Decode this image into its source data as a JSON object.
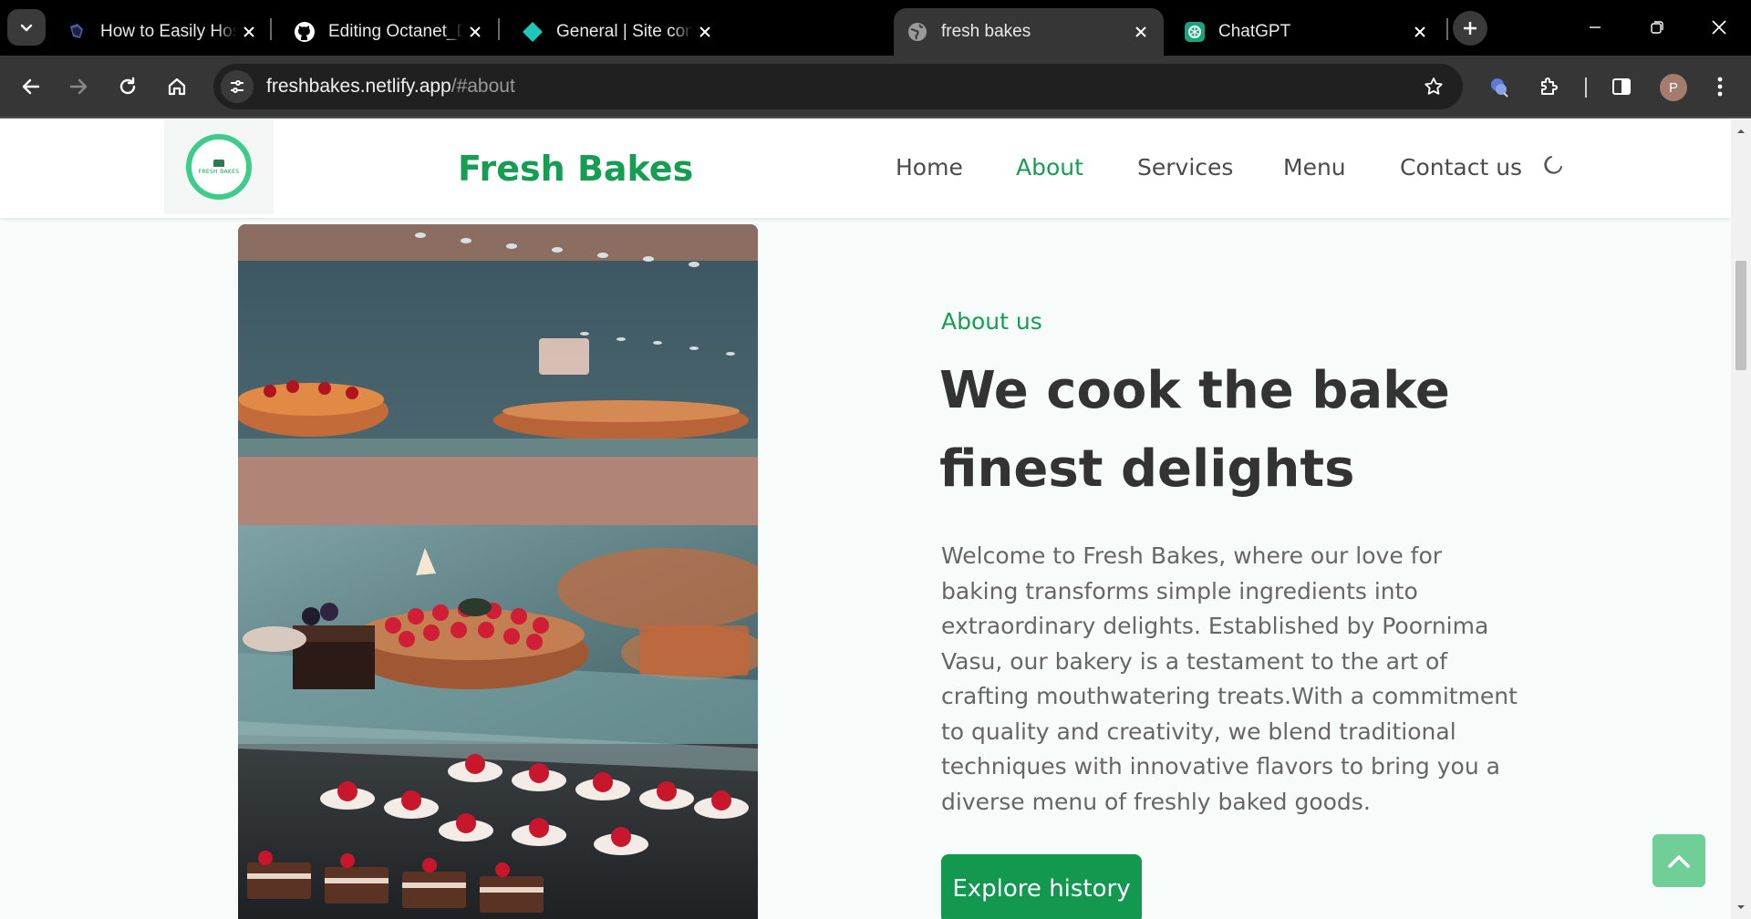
{
  "browser": {
    "tabs": [
      {
        "title": "How to Easily Host a Website",
        "favicon": "dev-icon",
        "active": false
      },
      {
        "title": "Editing Octanet_December",
        "favicon": "github-icon",
        "active": false
      },
      {
        "title": "General | Site configuration",
        "favicon": "netlify-icon",
        "active": false
      },
      {
        "title": "fresh bakes",
        "favicon": "globe-icon",
        "active": true
      },
      {
        "title": "ChatGPT",
        "favicon": "chatgpt-icon",
        "active": false
      }
    ],
    "url_host": "freshbakes.netlify.app",
    "url_path": "/#about",
    "profile_initial": "P"
  },
  "site": {
    "logo_text": "FRESH BAKES",
    "brand": "Fresh Bakes",
    "nav": [
      {
        "label": "Home",
        "active": false
      },
      {
        "label": "About",
        "active": true
      },
      {
        "label": "Services",
        "active": false
      },
      {
        "label": "Menu",
        "active": false
      },
      {
        "label": "Contact us",
        "active": false
      }
    ],
    "about": {
      "eyebrow": "About us",
      "headline": "We cook the bake finest delights",
      "body": "Welcome to Fresh Bakes, where our love for baking transforms simple ingredients into extraordinary delights. Established by Poornima Vasu, our bakery is a testament to the art of crafting mouthwatering treats.With a commitment to quality and creativity, we blend traditional techniques with innovative flavors to bring you a diverse menu of freshly baked goods.",
      "cta": "Explore history"
    }
  },
  "colors": {
    "brand_green": "#169c53",
    "button_green": "#12994f",
    "to_top_green": "#6fcf97"
  }
}
